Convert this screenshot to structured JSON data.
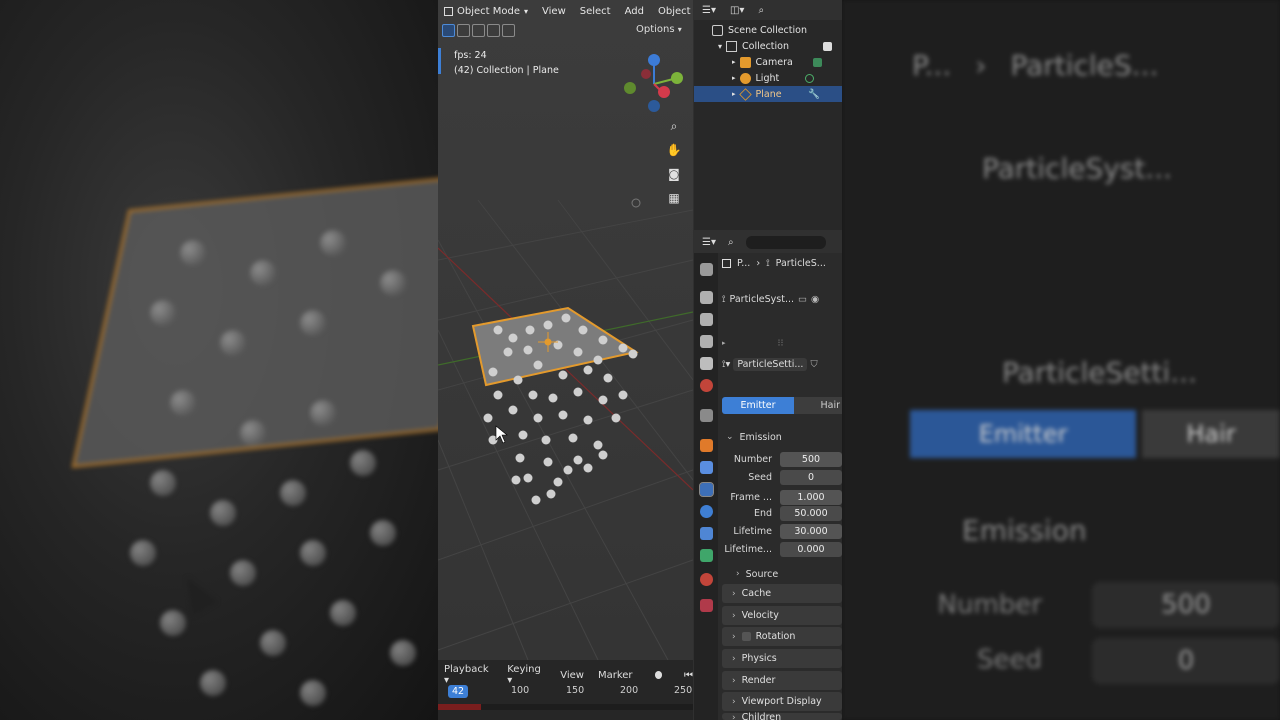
{
  "viewport": {
    "mode_label": "Object Mode",
    "menu": [
      "View",
      "Select",
      "Add",
      "Object"
    ],
    "options_label": "Options",
    "fps_text": "fps: 24",
    "collection_text": "(42) Collection | Plane"
  },
  "timeline": {
    "menu": [
      "Playback",
      "Keying",
      "View",
      "Marker"
    ],
    "current_frame": "42",
    "ticks": [
      "100",
      "150",
      "200",
      "250"
    ],
    "played_fraction": 0.168
  },
  "outliner": {
    "items": [
      {
        "label": "Scene Collection"
      },
      {
        "label": "Collection"
      },
      {
        "label": "Camera"
      },
      {
        "label": "Light"
      },
      {
        "label": "Plane"
      }
    ]
  },
  "properties": {
    "breadcrumb_first": "P...",
    "breadcrumb_second": "ParticleS...",
    "system_name": "ParticleSyst...",
    "settings_name": "ParticleSetti...",
    "type_emitter": "Emitter",
    "type_hair": "Hair",
    "emission_title": "Emission",
    "fields": [
      {
        "label": "Number",
        "value": "500"
      },
      {
        "label": "Seed",
        "value": "0"
      },
      {
        "label": "Frame ...",
        "value": "1.000"
      },
      {
        "label": "End",
        "value": "50.000"
      },
      {
        "label": "Lifetime",
        "value": "30.000"
      },
      {
        "label": "Lifetime...",
        "value": "0.000"
      }
    ],
    "source_label": "Source",
    "panels": [
      "Cache",
      "Velocity",
      "Rotation",
      "Physics",
      "Render",
      "Viewport Display",
      "Children"
    ]
  },
  "zoom": {
    "breadcrumb_first": "P...",
    "breadcrumb_second": "ParticleS...",
    "system_name": "ParticleSyst...",
    "settings_name": "ParticleSetti...",
    "tab_emitter": "Emitter",
    "tab_hair": "Hair",
    "emission_title": "Emission",
    "number_label": "Number",
    "number_value": "500",
    "seed_label": "Seed",
    "seed_value": "0"
  },
  "colors": {
    "accent_blue": "#3d7fd6",
    "selection_orange": "#e39a2d",
    "panel_bg": "#2b2b2b"
  }
}
